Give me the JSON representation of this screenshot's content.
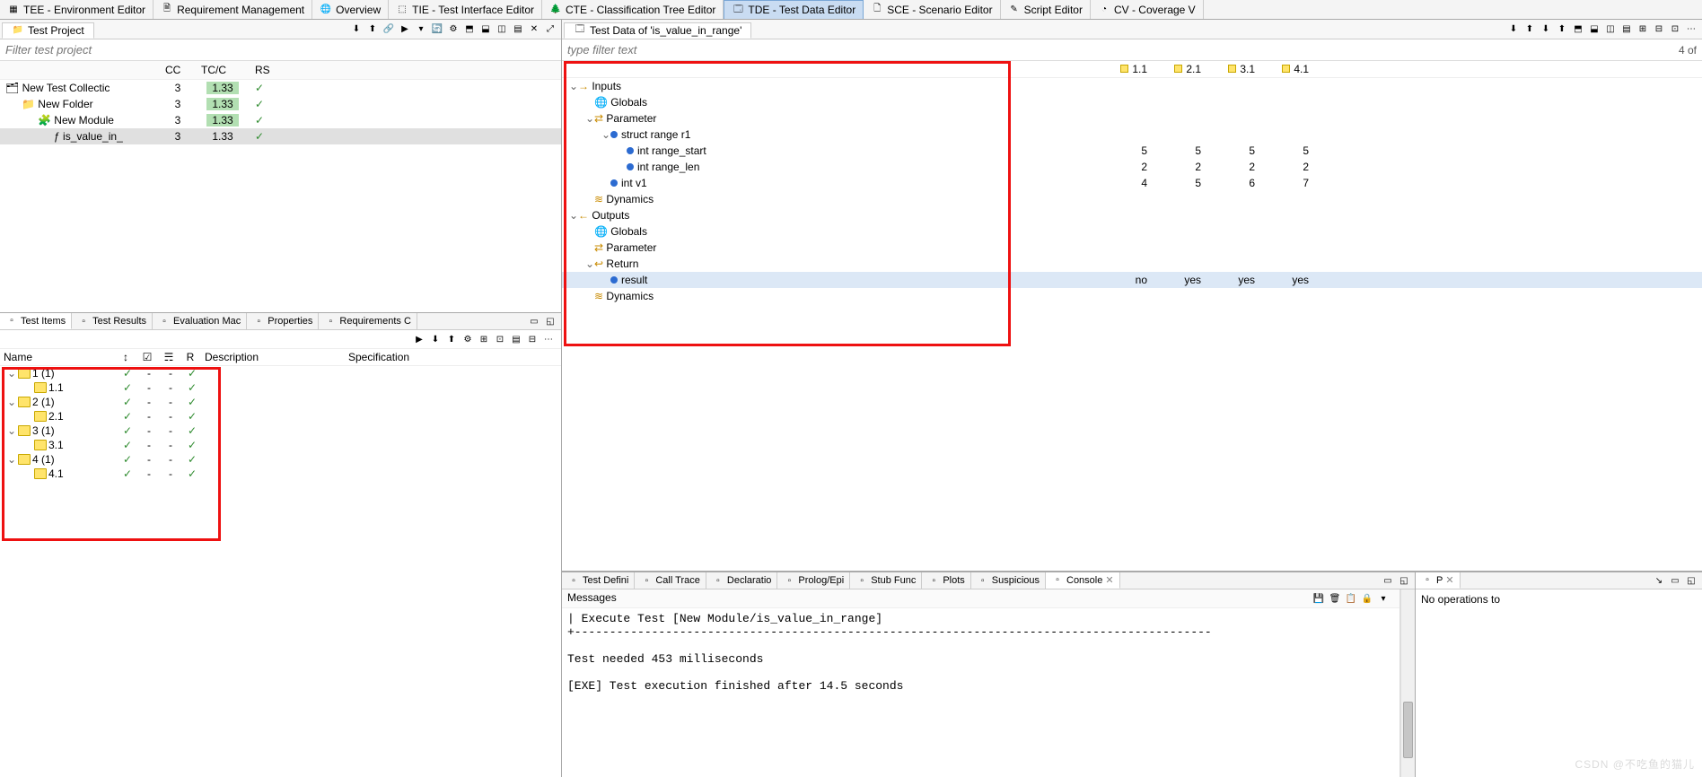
{
  "top_tabs": [
    {
      "label": "TEE - Environment Editor",
      "icon": "grid-icon"
    },
    {
      "label": "Requirement Management",
      "icon": "doc-icon"
    },
    {
      "label": "Overview",
      "icon": "globe-icon"
    },
    {
      "label": "TIE - Test Interface Editor",
      "icon": "iface-icon"
    },
    {
      "label": "CTE - Classification Tree Editor",
      "icon": "tree-icon"
    },
    {
      "label": "TDE - Test Data Editor",
      "icon": "data-icon",
      "active": true
    },
    {
      "label": "SCE - Scenario Editor",
      "icon": "scenario-icon"
    },
    {
      "label": "Script Editor",
      "icon": "script-icon"
    },
    {
      "label": "CV - Coverage V",
      "icon": "coverage-icon"
    }
  ],
  "left": {
    "project_panel_title": "Test Project",
    "filter_placeholder": "Filter test project",
    "cols": {
      "name": "",
      "cc": "CC",
      "tcc": "TC/C",
      "rs": "RS"
    },
    "rows": [
      {
        "indent": 0,
        "icon": "collection-icon",
        "name": "New Test Collectic",
        "cc": "3",
        "tcc": "1.33",
        "rs": "✓",
        "hl": true
      },
      {
        "indent": 1,
        "icon": "folder-icon",
        "name": "New Folder",
        "cc": "3",
        "tcc": "1.33",
        "rs": "✓",
        "hl": true
      },
      {
        "indent": 2,
        "icon": "module-icon",
        "name": "New Module",
        "cc": "3",
        "tcc": "1.33",
        "rs": "✓",
        "hl": true
      },
      {
        "indent": 3,
        "icon": "func-icon",
        "name": "is_value_in_",
        "cc": "3",
        "tcc": "1.33",
        "rs": "✓",
        "sel": true
      }
    ],
    "bottom_tabs": [
      {
        "label": "Test Items",
        "icon": "items-icon",
        "active": true
      },
      {
        "label": "Test Results",
        "icon": "results-icon"
      },
      {
        "label": "Evaluation Mac",
        "icon": "eval-icon"
      },
      {
        "label": "Properties",
        "icon": "props-icon"
      },
      {
        "label": "Requirements C",
        "icon": "req-icon"
      }
    ],
    "items_cols": {
      "name": "Name",
      "c1": "↕",
      "c2": "☑",
      "c3": "☴",
      "c4": "R",
      "desc": "Description",
      "spec": "Specification"
    },
    "items": [
      {
        "indent": 0,
        "exp": "⌄",
        "name": "1 (1)",
        "c": [
          "✓",
          "-",
          "-",
          "✓"
        ]
      },
      {
        "indent": 1,
        "exp": "",
        "name": "1.1",
        "c": [
          "✓",
          "-",
          "-",
          "✓"
        ]
      },
      {
        "indent": 0,
        "exp": "⌄",
        "name": "2 (1)",
        "c": [
          "✓",
          "-",
          "-",
          "✓"
        ]
      },
      {
        "indent": 1,
        "exp": "",
        "name": "2.1",
        "c": [
          "✓",
          "-",
          "-",
          "✓"
        ]
      },
      {
        "indent": 0,
        "exp": "⌄",
        "name": "3 (1)",
        "c": [
          "✓",
          "-",
          "-",
          "✓"
        ]
      },
      {
        "indent": 1,
        "exp": "",
        "name": "3.1",
        "c": [
          "✓",
          "-",
          "-",
          "✓"
        ]
      },
      {
        "indent": 0,
        "exp": "⌄",
        "name": "4 (1)",
        "c": [
          "✓",
          "-",
          "-",
          "✓"
        ]
      },
      {
        "indent": 1,
        "exp": "",
        "name": "4.1",
        "c": [
          "✓",
          "-",
          "-",
          "✓"
        ]
      }
    ]
  },
  "right": {
    "td_title": "Test Data of 'is_value_in_range'",
    "filter_placeholder": "type filter text",
    "filter_count": "4 of",
    "col_heads": [
      "1.1",
      "2.1",
      "3.1",
      "4.1"
    ],
    "rows": [
      {
        "indent": 0,
        "exp": "⌄",
        "kind": "in",
        "name": "Inputs"
      },
      {
        "indent": 1,
        "exp": "",
        "kind": "glob",
        "name": "Globals"
      },
      {
        "indent": 1,
        "exp": "⌄",
        "kind": "param",
        "name": "Parameter"
      },
      {
        "indent": 2,
        "exp": "⌄",
        "kind": "var",
        "name": "struct range r1"
      },
      {
        "indent": 3,
        "exp": "",
        "kind": "var",
        "name": "int range_start",
        "vals": [
          "5",
          "5",
          "5",
          "5"
        ]
      },
      {
        "indent": 3,
        "exp": "",
        "kind": "var",
        "name": "int range_len",
        "vals": [
          "2",
          "2",
          "2",
          "2"
        ]
      },
      {
        "indent": 2,
        "exp": "",
        "kind": "var",
        "name": "int v1",
        "vals": [
          "4",
          "5",
          "6",
          "7"
        ]
      },
      {
        "indent": 1,
        "exp": "",
        "kind": "dyn",
        "name": "Dynamics"
      },
      {
        "indent": 0,
        "exp": "⌄",
        "kind": "out",
        "name": "Outputs"
      },
      {
        "indent": 1,
        "exp": "",
        "kind": "glob",
        "name": "Globals"
      },
      {
        "indent": 1,
        "exp": "",
        "kind": "param",
        "name": "Parameter"
      },
      {
        "indent": 1,
        "exp": "⌄",
        "kind": "ret",
        "name": "Return"
      },
      {
        "indent": 2,
        "exp": "",
        "kind": "var",
        "name": "result",
        "vals": [
          "no",
          "yes",
          "yes",
          "yes"
        ],
        "sel": true
      },
      {
        "indent": 1,
        "exp": "",
        "kind": "dyn",
        "name": "Dynamics"
      }
    ],
    "bottom_tabs": [
      {
        "label": "Test Defini",
        "icon": "bulb-icon"
      },
      {
        "label": "Call Trace",
        "icon": "trace-icon"
      },
      {
        "label": "Declaratio",
        "icon": "decl-icon"
      },
      {
        "label": "Prolog/Epi",
        "icon": "prolog-icon"
      },
      {
        "label": "Stub Func",
        "icon": "stub-icon"
      },
      {
        "label": "Plots",
        "icon": "plots-icon"
      },
      {
        "label": "Suspicious",
        "icon": "susp-icon"
      },
      {
        "label": "Console",
        "icon": "console-icon",
        "active": true,
        "closeable": true
      }
    ],
    "right_tabs": [
      {
        "label": "P",
        "icon": "progress-icon",
        "active": true,
        "closeable": true
      }
    ],
    "msg_header": "Messages",
    "console_text": "| Execute Test [New Module/is_value_in_range]\n+-------------------------------------------------------------------------------------------\n\nTest needed 453 milliseconds\n\n[EXE] Test execution finished after 14.5 seconds",
    "progress_text": "No operations to"
  },
  "watermark": "CSDN @不吃鱼的猫儿"
}
